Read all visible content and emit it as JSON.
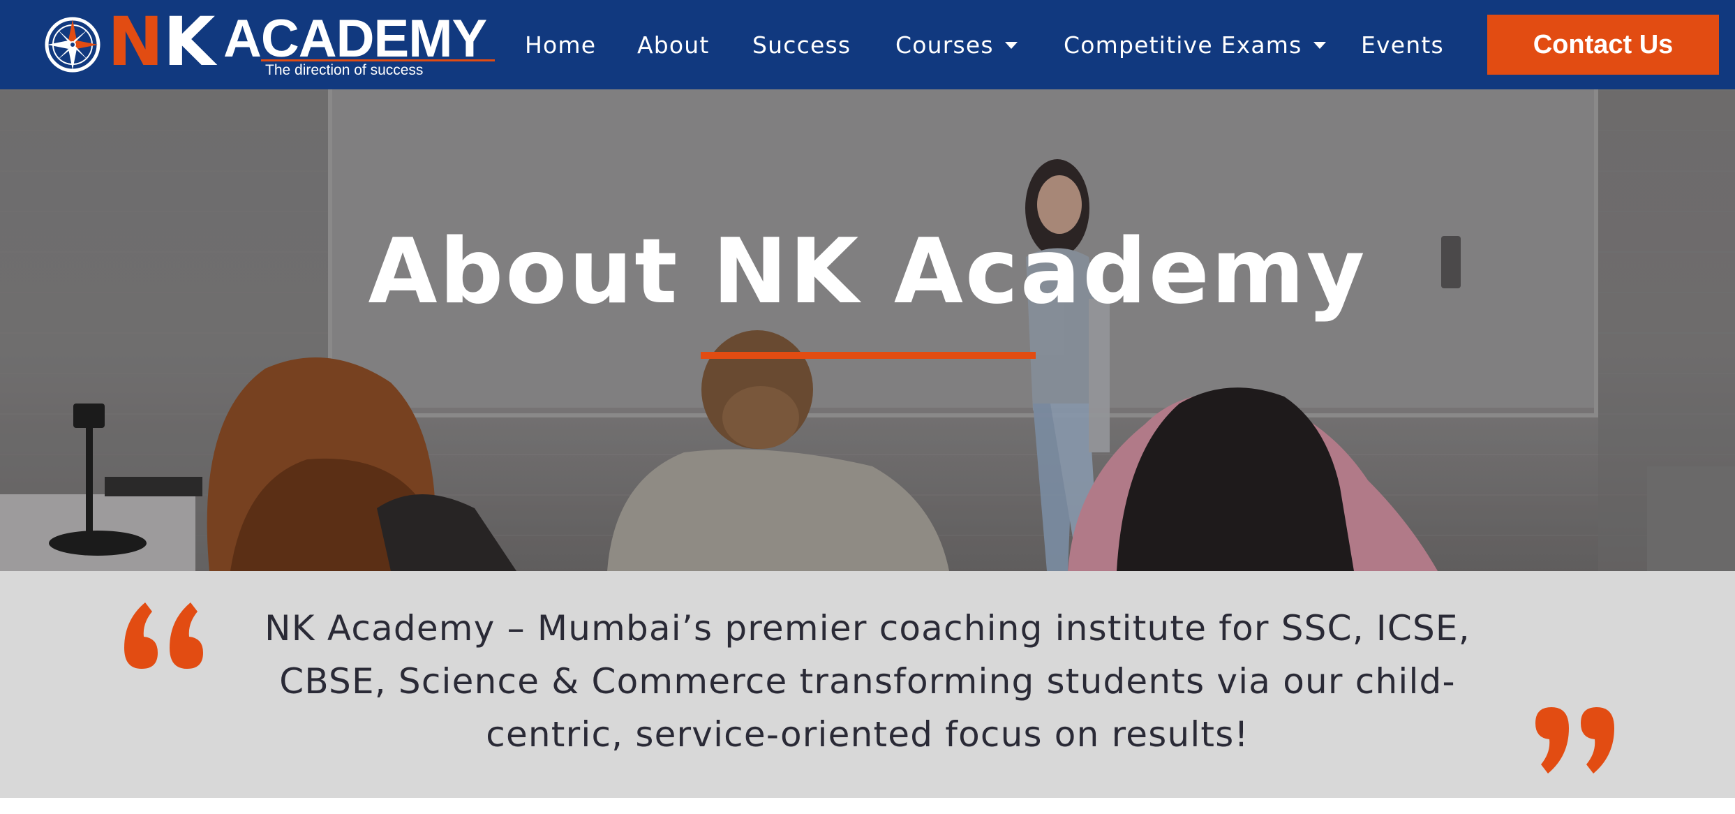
{
  "brand": {
    "name_n": "N",
    "name_k": "K",
    "name_word": "ACADEMY",
    "tagline": "The direction of success"
  },
  "nav": {
    "items": [
      {
        "label": "Home",
        "dropdown": false
      },
      {
        "label": "About",
        "dropdown": false
      },
      {
        "label": "Success",
        "dropdown": false
      },
      {
        "label": "Courses",
        "dropdown": true
      },
      {
        "label": "Competitive Exams",
        "dropdown": true
      },
      {
        "label": "Events",
        "dropdown": false
      }
    ],
    "cta_label": "Contact Us"
  },
  "hero": {
    "title": "About NK Academy"
  },
  "quote": {
    "text": "NK Academy – Mumbai’s premier coaching institute for SSC, ICSE, CBSE, Science & Commerce transforming students via our child-centric, service-oriented focus on results!"
  },
  "colors": {
    "navbar": "#11397f",
    "accent": "#e24c12",
    "quote_band": "#d8d8d8",
    "quote_text": "#2a2a36"
  },
  "icons": {
    "logo_emblem": "compass-icon",
    "dropdown": "caret-down-icon",
    "quote_open": "quote-open-icon",
    "quote_close": "quote-close-icon"
  }
}
